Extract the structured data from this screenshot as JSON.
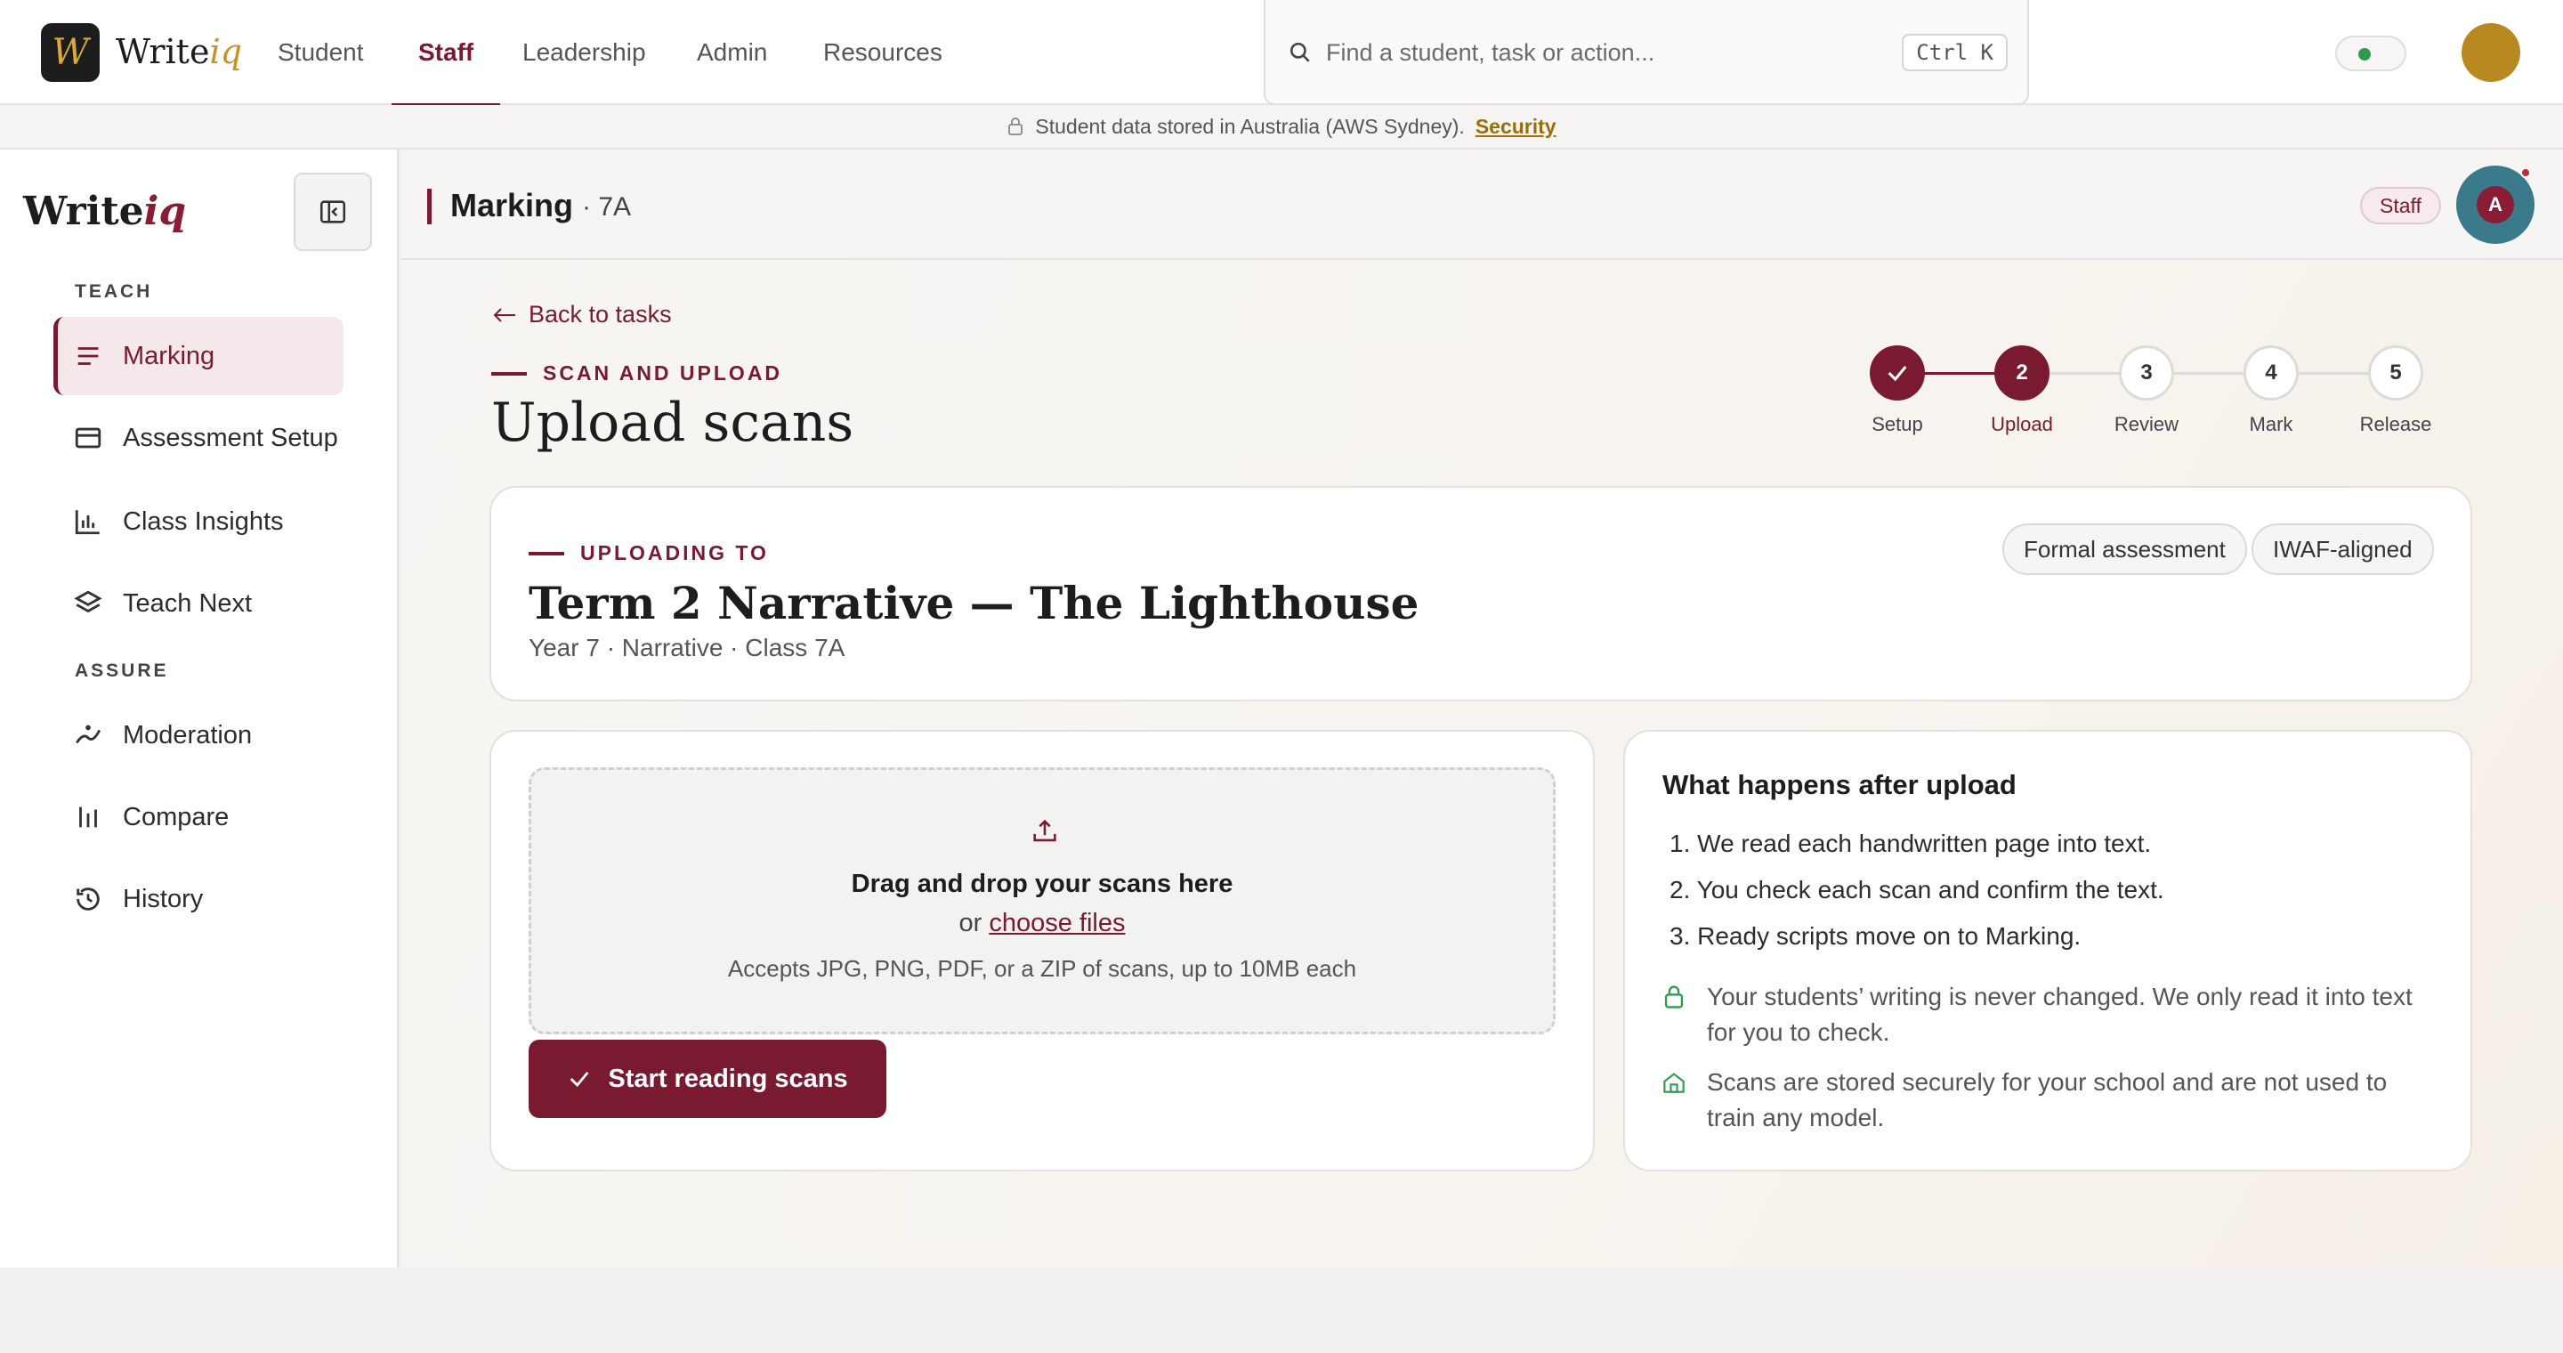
{
  "topnav": {
    "logo_letter": "W",
    "brand_main": "Write",
    "brand_accent": "iq",
    "tabs": [
      {
        "label": "Student",
        "active": false
      },
      {
        "label": "Staff",
        "active": true
      },
      {
        "label": "Leadership",
        "active": false
      },
      {
        "label": "Admin",
        "active": false
      },
      {
        "label": "Resources",
        "active": false
      }
    ],
    "search_placeholder": "Find a student, task or action...",
    "search_shortcut": "Ctrl K",
    "status_color": "#2e9a4c"
  },
  "banner": {
    "text": "Student data stored in Australia (AWS Sydney).",
    "link": "Security",
    "icon": "lock-icon"
  },
  "sidebar": {
    "brand_main": "Write",
    "brand_accent": "iq",
    "collapse_icon": "panel-collapse-icon",
    "sections": [
      {
        "label": "TEACH"
      },
      {
        "label": "ASSURE"
      }
    ],
    "items": [
      {
        "label": "Marking",
        "icon": "list-icon",
        "active": true
      },
      {
        "label": "Assessment Setup",
        "icon": "card-icon",
        "active": false
      },
      {
        "label": "Class Insights",
        "icon": "bar-chart-icon",
        "active": false
      },
      {
        "label": "Teach Next",
        "icon": "layers-icon",
        "active": false
      },
      {
        "label": "Moderation",
        "icon": "trend-icon",
        "active": false
      },
      {
        "label": "Compare",
        "icon": "compare-bars-icon",
        "active": false
      },
      {
        "label": "History",
        "icon": "history-icon",
        "active": false
      }
    ]
  },
  "header": {
    "title": "Marking",
    "subtitle": "· 7A",
    "role_badge": "Staff",
    "avatar_initial": "A"
  },
  "page": {
    "back_label": "Back to tasks",
    "eyebrow": "SCAN AND UPLOAD",
    "title": "Upload scans"
  },
  "stepper": {
    "steps": [
      {
        "number": "1",
        "label": "Setup",
        "state": "done"
      },
      {
        "number": "2",
        "label": "Upload",
        "state": "current"
      },
      {
        "number": "3",
        "label": "Review",
        "state": "todo"
      },
      {
        "number": "4",
        "label": "Mark",
        "state": "todo"
      },
      {
        "number": "5",
        "label": "Release",
        "state": "todo"
      }
    ]
  },
  "target": {
    "eyebrow": "UPLOADING TO",
    "title": "Term 2 Narrative — The Lighthouse",
    "meta": "Year 7 · Narrative · Class 7A",
    "tags": [
      "Formal assessment",
      "IWAF-aligned"
    ]
  },
  "upload": {
    "drop_title": "Drag and drop your scans here",
    "or_text": "or",
    "choose_link": "choose files",
    "accepts": "Accepts JPG, PNG, PDF, or a ZIP of scans, up to 10MB each",
    "start_button": "Start reading scans"
  },
  "info": {
    "title": "What happens after upload",
    "steps": [
      "We read each handwritten page into text.",
      "You check each scan and confirm the text.",
      "Ready scripts move on to Marking."
    ],
    "notes": [
      {
        "icon": "lock-icon",
        "text": "Your students’ writing is never changed. We only read it into text for you to check."
      },
      {
        "icon": "school-icon",
        "text": "Scans are stored securely for your school and are not used to train any model."
      }
    ]
  },
  "colors": {
    "accent": "#7a1a30",
    "gold": "#c79127",
    "success": "#2e9a4c"
  }
}
